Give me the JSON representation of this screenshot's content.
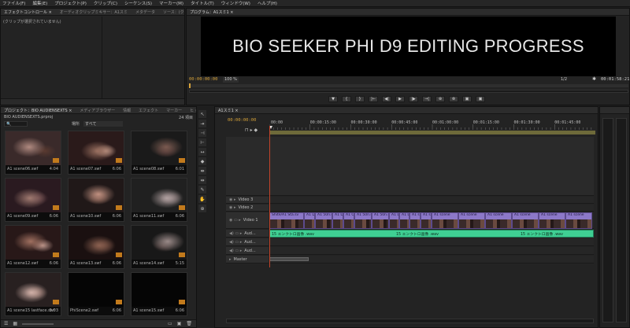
{
  "menu": [
    "ファイル(F)",
    "編集(E)",
    "プロジェクト(P)",
    "クリップ(C)",
    "シーケンス(S)",
    "マーカー(M)",
    "タイトル(T)",
    "ウィンドウ(W)",
    "ヘルプ(H)"
  ],
  "source_panel": {
    "tabs": [
      "エフェクトコントロール ×",
      "オーディオクリップミキサー：A1スミ",
      "メタデータ",
      "ソース：(クリップなし)"
    ],
    "message": "(クリップが選択されていません)"
  },
  "program_monitor": {
    "tab": "プログラム：A1スミ1 ×",
    "title": "BIO SEEKER PHI D9 EDITING PROGRESS",
    "timecode_current": "00:00:00:00",
    "zoom": "100 %",
    "resolution": "1/2",
    "timecode_duration": "00:01:58:21",
    "transport_buttons": [
      "▼",
      "{",
      "}",
      "|←",
      "◀|",
      "▶",
      "|▶",
      "→|",
      "⊕",
      "⊗",
      "▣",
      "▣"
    ]
  },
  "project_panel": {
    "tabs": [
      "プロジェクト：BIO AUDIENSEXTS ×",
      "メディアブラウザー",
      "情報",
      "エフェクト",
      "マーカー",
      "ヒ »"
    ],
    "filename": "BIO AUDIENSEXTS.prproj",
    "item_count": "24 項目",
    "search_label": "場所",
    "search_value": "すべて",
    "items": [
      {
        "name": "A1 scene06.swf",
        "duration": "4:04",
        "dark": false
      },
      {
        "name": "A1 scene07.swf",
        "duration": "6:06",
        "dark": false
      },
      {
        "name": "A1 scene08.swf",
        "duration": "6:01",
        "dark": false
      },
      {
        "name": "A1 scene09.swf",
        "duration": "6:06",
        "dark": false
      },
      {
        "name": "A1 scene10.swf",
        "duration": "6:06",
        "dark": false
      },
      {
        "name": "A1 scene11.swf",
        "duration": "6:06",
        "dark": false
      },
      {
        "name": "A1 scene12.swf",
        "duration": "6:06",
        "dark": false
      },
      {
        "name": "A1 scene13.swf",
        "duration": "6:06",
        "dark": false
      },
      {
        "name": "A1 scene14.swf",
        "duration": "5:15",
        "dark": false
      },
      {
        "name": "A1 scene15 lastface.swf",
        "duration": "5:03",
        "dark": false
      },
      {
        "name": "PhiScene2.swf",
        "duration": "6:06",
        "dark": true
      },
      {
        "name": "A1 scene15.swf",
        "duration": "6:06",
        "dark": true
      }
    ]
  },
  "timeline": {
    "tab": "A1スミ1 ×",
    "timecode": "00:00:00:00",
    "ruler_labels": [
      "00:00",
      "00:00:15:00",
      "00:00:30:00",
      "00:00:45:00",
      "00:01:00:00",
      "00:01:15:00",
      "00:01:30:00",
      "00:01:45:00"
    ],
    "tracks": {
      "video3": "Video 3",
      "video2": "Video 2",
      "video1": "Video 1",
      "audio1": "Aud...",
      "audio2": "Aud...",
      "audio3": "Aud...",
      "master": "Master"
    },
    "video_clip_labels": [
      "Shite/A1 Sta.sv",
      "A1 Dif",
      "A1 50n.sv",
      "A1 Dif",
      "A1 O0",
      "A1 50n.sv",
      "A1 50n.sv",
      "A1 Di",
      "A1 Di",
      "A1 sce",
      "A1 sce",
      "A1 scene",
      "A1 scene",
      "A1 scene",
      "A1 scene",
      "A1 scene",
      "A1 scene"
    ],
    "audio_clip_label": "15 エンクトロ画像 .wav",
    "audio_color": "#3fcf93",
    "video_color": "#8c78c8"
  }
}
